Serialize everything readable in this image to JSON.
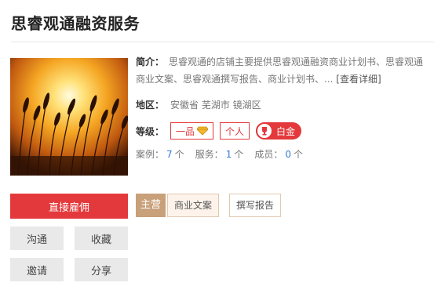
{
  "shop": {
    "title": "思睿观通融资服务",
    "intro_label": "简介：",
    "intro_text": "思睿观通的店铺主要提供思睿观通融资商业计划书、思睿观通商业文案、思睿观通撰写报告、商业计划书、...",
    "intro_more": "[查看详细]",
    "region_label": "地区：",
    "region_value": "安徽省 芜湖市 镜湖区",
    "level_label": "等级：",
    "level_tags": [
      "一品",
      "个人"
    ],
    "platinum_label": "白金",
    "stats": {
      "cases_label": "案例：",
      "cases_value": "7",
      "services_label": "服务：",
      "services_value": "1",
      "members_label": "成员：",
      "members_value": "0",
      "unit": "个"
    }
  },
  "actions": {
    "hire": "直接雇佣",
    "chat": "沟通",
    "favorite": "收藏",
    "invite": "邀请",
    "share": "分享"
  },
  "main_business": {
    "label": "主营",
    "categories": [
      "商业文案",
      "撰写报告"
    ]
  },
  "colors": {
    "accent_red": "#e4393c",
    "main_label_bg": "#c8a07a",
    "link_blue": "#3a7bd5"
  },
  "icons": [
    "diamond-icon",
    "trophy-icon",
    "shop-image-wheat-sunset"
  ]
}
